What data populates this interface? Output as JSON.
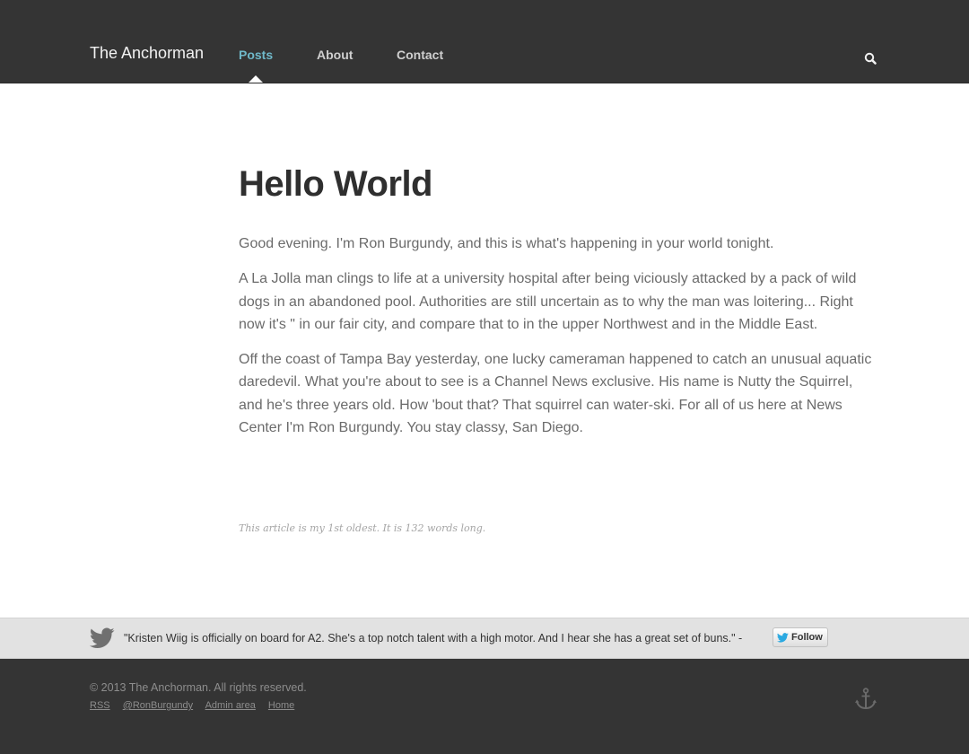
{
  "header": {
    "brand": "The Anchorman",
    "nav": [
      {
        "label": "Posts",
        "active": true
      },
      {
        "label": "About",
        "active": false
      },
      {
        "label": "Contact",
        "active": false
      }
    ],
    "search_icon": "search-icon"
  },
  "post": {
    "title": "Hello World",
    "paragraphs": [
      "Good evening. I'm Ron Burgundy, and this is what's happening in your world tonight.",
      "A La Jolla man clings to life at a university hospital after being viciously attacked by a pack of wild dogs in an abandoned pool. Authorities are still uncertain as to why the man was loitering... Right now it's \" in our fair city, and compare that to in the upper Northwest and in the Middle East.",
      "Off the coast of Tampa Bay yesterday, one lucky cameraman happened to catch an unusual aquatic daredevil. What you're about to see is a Channel News exclusive. His name is Nutty the Squirrel, and he's three years old. How 'bout that? That squirrel can water-ski. For all of us here at News Center I'm Ron Burgundy. You stay classy, San Diego."
    ],
    "meta": "This article is my 1st oldest. It is 132 words long."
  },
  "tweet": {
    "text": "\"Kristen Wiig is officially on board for A2. She's a top notch talent with a high motor. And I hear she has a great set of buns.\" -",
    "follow_label": "Follow",
    "icon": "twitter-bird-icon"
  },
  "footer": {
    "copyright": "© 2013 The Anchorman. All rights reserved.",
    "links": [
      "RSS",
      "@RonBurgundy",
      "Admin area",
      "Home"
    ],
    "icon": "anchor-icon"
  },
  "colors": {
    "header_bg": "#343434",
    "accent": "#6fb8c9",
    "tweet_bar_bg": "#e2e2e2",
    "body_text": "#6b6b6b"
  }
}
